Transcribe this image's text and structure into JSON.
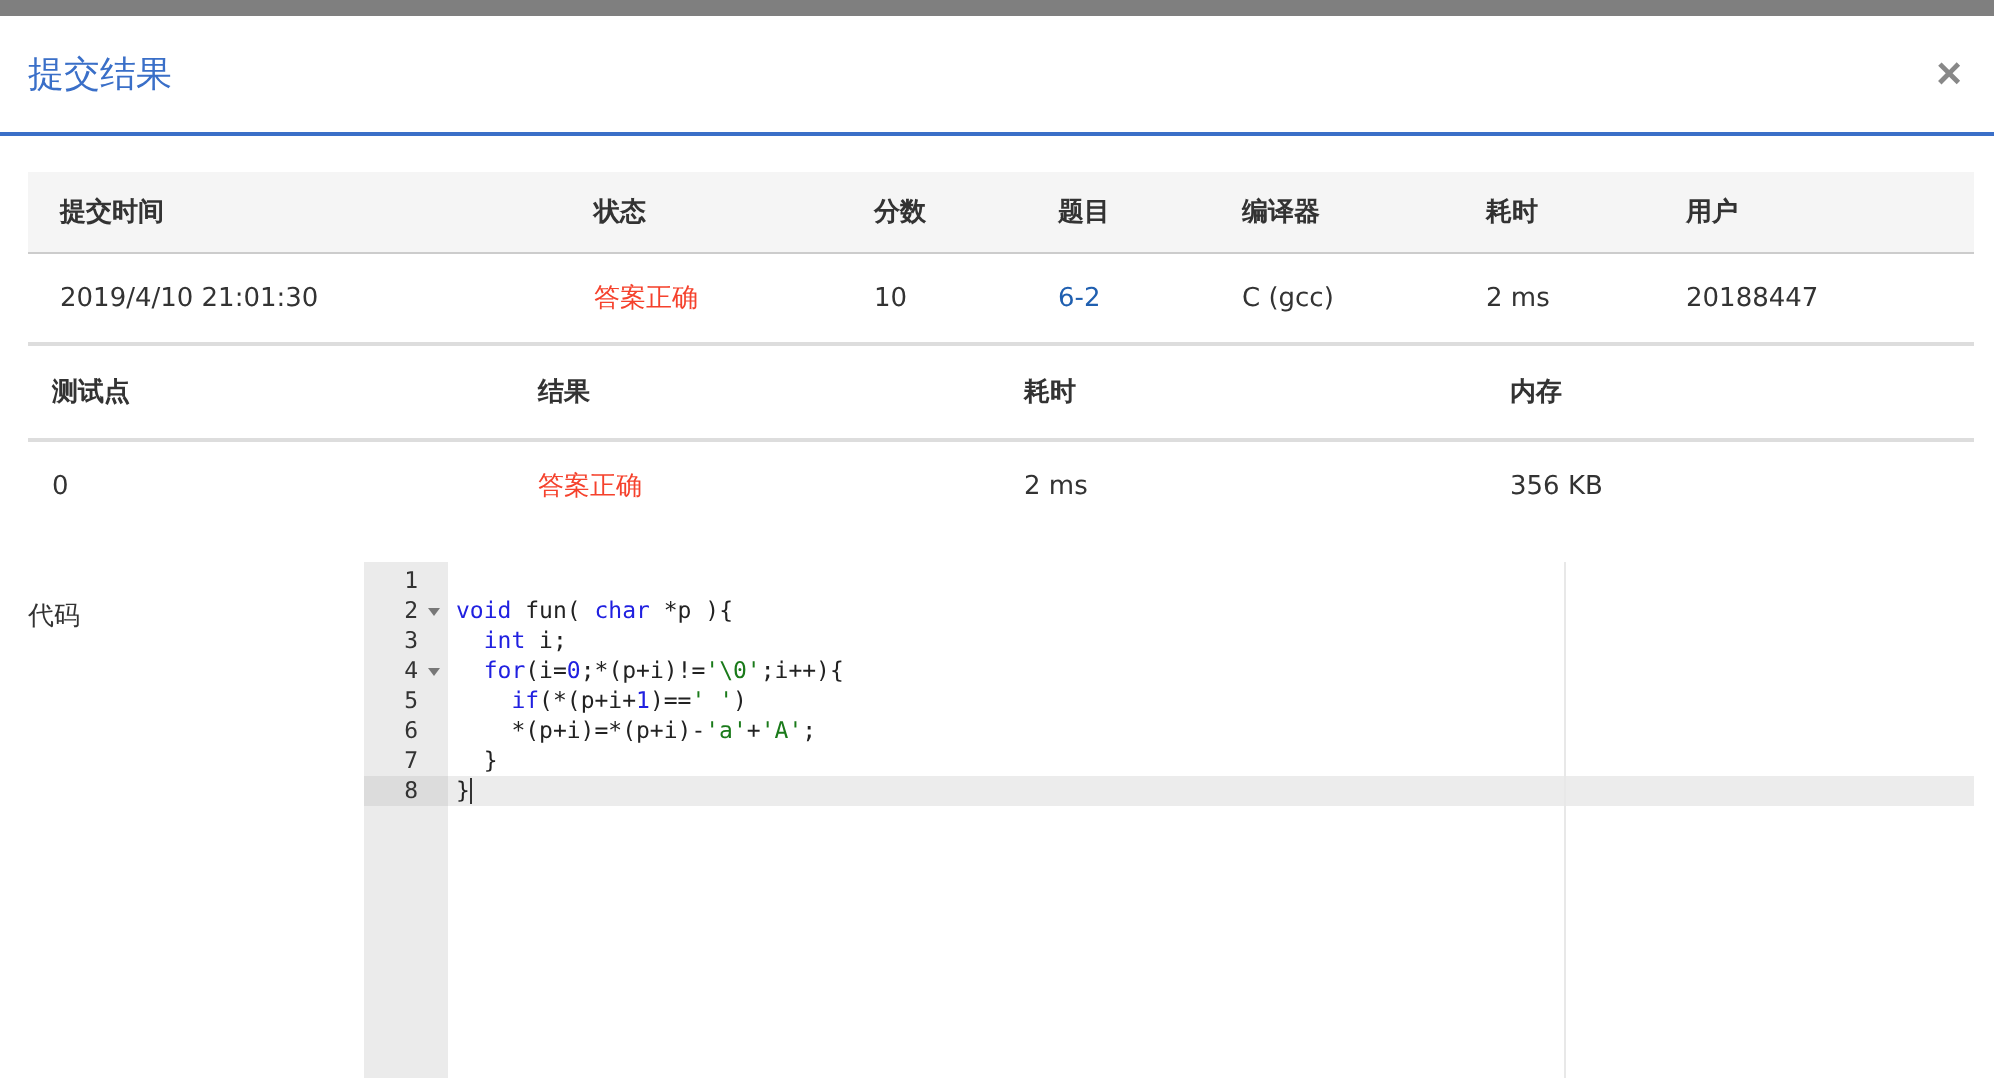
{
  "dialog": {
    "title": "提交结果",
    "close": "×"
  },
  "summary_table": {
    "columns": [
      "提交时间",
      "状态",
      "分数",
      "题目",
      "编译器",
      "耗时",
      "用户"
    ],
    "rows": [
      [
        {
          "text": "2019/4/10 21:01:30",
          "kind": "plain"
        },
        {
          "text": "答案正确",
          "kind": "status"
        },
        {
          "text": "10",
          "kind": "plain"
        },
        {
          "text": "6-2",
          "kind": "link"
        },
        {
          "text": "C (gcc)",
          "kind": "plain"
        },
        {
          "text": "2 ms",
          "kind": "plain"
        },
        {
          "text": "20188447",
          "kind": "plain"
        }
      ]
    ]
  },
  "testcase_table": {
    "columns": [
      "测试点",
      "结果",
      "耗时",
      "内存"
    ],
    "rows": [
      [
        {
          "text": "0",
          "kind": "plain"
        },
        {
          "text": "答案正确",
          "kind": "status"
        },
        {
          "text": "2 ms",
          "kind": "plain"
        },
        {
          "text": "356 KB",
          "kind": "plain"
        }
      ]
    ]
  },
  "code": {
    "label": "代码",
    "lines": [
      {
        "number": "1",
        "foldable": false,
        "active": false
      },
      {
        "number": "2",
        "foldable": true,
        "active": false,
        "tokens": [
          {
            "kind": "keyword",
            "text": "void"
          },
          {
            "kind": "plain",
            "text": " fun( "
          },
          {
            "kind": "keyword",
            "text": "char"
          },
          {
            "kind": "plain",
            "text": " *p ){"
          }
        ]
      },
      {
        "number": "3",
        "foldable": false,
        "active": false,
        "tokens": [
          {
            "kind": "keyword",
            "text": "  int"
          },
          {
            "kind": "plain",
            "text": " i;"
          }
        ]
      },
      {
        "number": "4",
        "foldable": true,
        "active": false,
        "tokens": [
          {
            "kind": "keyword",
            "text": "  for"
          },
          {
            "kind": "plain",
            "text": "(i="
          },
          {
            "kind": "number",
            "text": "0"
          },
          {
            "kind": "plain",
            "text": ";*(p+i)!="
          },
          {
            "kind": "string",
            "text": "'\\0'"
          },
          {
            "kind": "plain",
            "text": ";i++){"
          }
        ]
      },
      {
        "number": "5",
        "foldable": false,
        "active": false,
        "tokens": [
          {
            "kind": "keyword",
            "text": "    if"
          },
          {
            "kind": "plain",
            "text": "(*(p+i+"
          },
          {
            "kind": "number",
            "text": "1"
          },
          {
            "kind": "plain",
            "text": ")=="
          },
          {
            "kind": "string",
            "text": "' '"
          },
          {
            "kind": "plain",
            "text": ")"
          }
        ]
      },
      {
        "number": "6",
        "foldable": false,
        "active": false,
        "tokens": [
          {
            "kind": "plain",
            "text": "    *(p+i)=*(p+i)-"
          },
          {
            "kind": "string",
            "text": "'a'"
          },
          {
            "kind": "plain",
            "text": "+"
          },
          {
            "kind": "string",
            "text": "'A'"
          },
          {
            "kind": "plain",
            "text": ";"
          }
        ]
      },
      {
        "number": "7",
        "foldable": false,
        "active": false,
        "tokens": [
          {
            "kind": "plain",
            "text": "  }"
          }
        ]
      },
      {
        "number": "8",
        "foldable": false,
        "active": true,
        "tokens": [
          {
            "kind": "plain",
            "text": "}"
          }
        ]
      }
    ]
  }
}
